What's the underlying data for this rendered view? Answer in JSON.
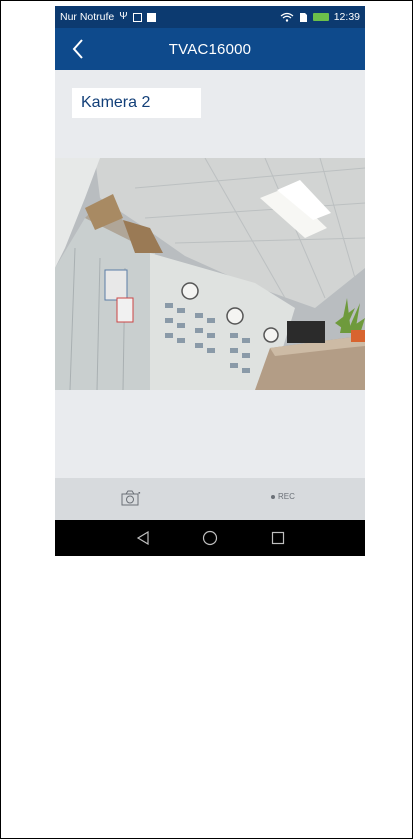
{
  "status_bar": {
    "carrier": "Nur Notrufe",
    "time": "12:39",
    "icons": [
      "usb-icon",
      "image-icon",
      "notification-icon",
      "wifi-icon",
      "sim-icon",
      "battery-icon"
    ]
  },
  "app_bar": {
    "title": "TVAC16000",
    "back_icon": "chevron-left-icon"
  },
  "camera": {
    "name": "Kamera 2"
  },
  "toolbar": {
    "snapshot_icon": "camera-icon",
    "rec_label": "REC"
  },
  "nav_bar": {
    "icons": [
      "back-triangle-icon",
      "home-circle-icon",
      "recents-square-icon"
    ]
  },
  "colors": {
    "status_bar": "#0c3a70",
    "app_bar": "#0e4a8c",
    "background": "#e9ebee",
    "toolbar": "#d7dadd",
    "camera_name_text": "#123f78"
  }
}
